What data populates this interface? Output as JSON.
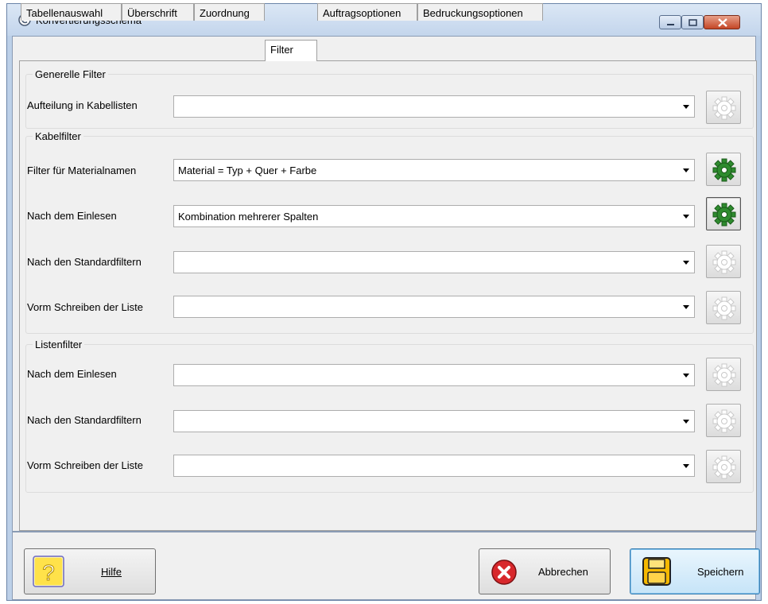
{
  "window": {
    "title": "Konvertierungsschema"
  },
  "tabs": [
    {
      "label": "Tabellenauswahl"
    },
    {
      "label": "Überschrift"
    },
    {
      "label": "Zuordnung"
    },
    {
      "label": "Filter",
      "active": true
    },
    {
      "label": "Auftragsoptionen"
    },
    {
      "label": "Bedruckungsoptionen"
    }
  ],
  "general": {
    "legend": "Generelle Filter",
    "rows": [
      {
        "label": "Aufteilung in Kabellisten",
        "value": ""
      }
    ]
  },
  "cable": {
    "legend": "Kabelfilter",
    "rows": [
      {
        "label": "Filter für Materialnamen",
        "value": "Material = Typ + Quer + Farbe"
      },
      {
        "label": "Nach dem Einlesen",
        "value": "Kombination mehrerer Spalten"
      },
      {
        "label": "Nach den Standardfiltern",
        "value": ""
      },
      {
        "label": "Vorm Schreiben der Liste",
        "value": ""
      }
    ]
  },
  "list": {
    "legend": "Listenfilter",
    "rows": [
      {
        "label": "Nach dem Einlesen",
        "value": ""
      },
      {
        "label": "Nach den Standardfiltern",
        "value": ""
      },
      {
        "label": "Vorm Schreiben der Liste",
        "value": ""
      }
    ]
  },
  "buttons": {
    "help": "Hilfe",
    "cancel": "Abbrechen",
    "save": "Speichern"
  },
  "colors": {
    "gear_active": "#2e8b2e",
    "gear_inactive": "#c8c8c8"
  }
}
